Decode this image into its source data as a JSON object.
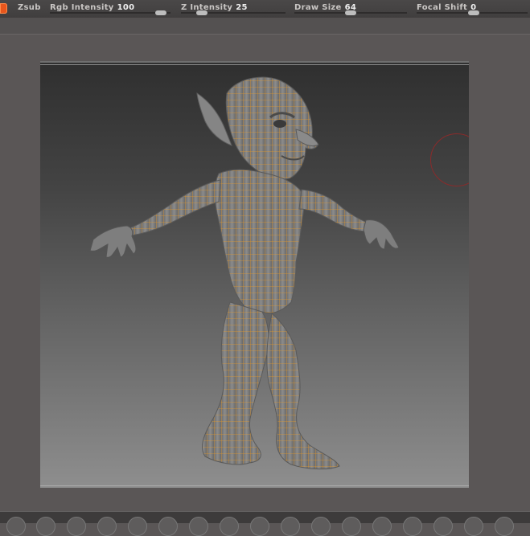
{
  "toolbar": {
    "zsub_label": "Zsub",
    "rgb_intensity": {
      "label": "Rgb Intensity",
      "value": "100",
      "level": 1.0
    },
    "z_intensity": {
      "label": "Z Intensity",
      "value": "25",
      "level": 0.25
    },
    "draw_size": {
      "label": "Draw Size",
      "value": "64"
    },
    "focal_shift": {
      "label": "Focal Shift",
      "value": "0"
    }
  },
  "colors": {
    "accent_orange": "#e8561c",
    "wireframe": "#e89a2a",
    "model_gray": "#808080",
    "brush_ring": "#8a2b2b"
  },
  "canvas": {
    "subject": "goblin-model-with-polygroup-wireframe"
  }
}
